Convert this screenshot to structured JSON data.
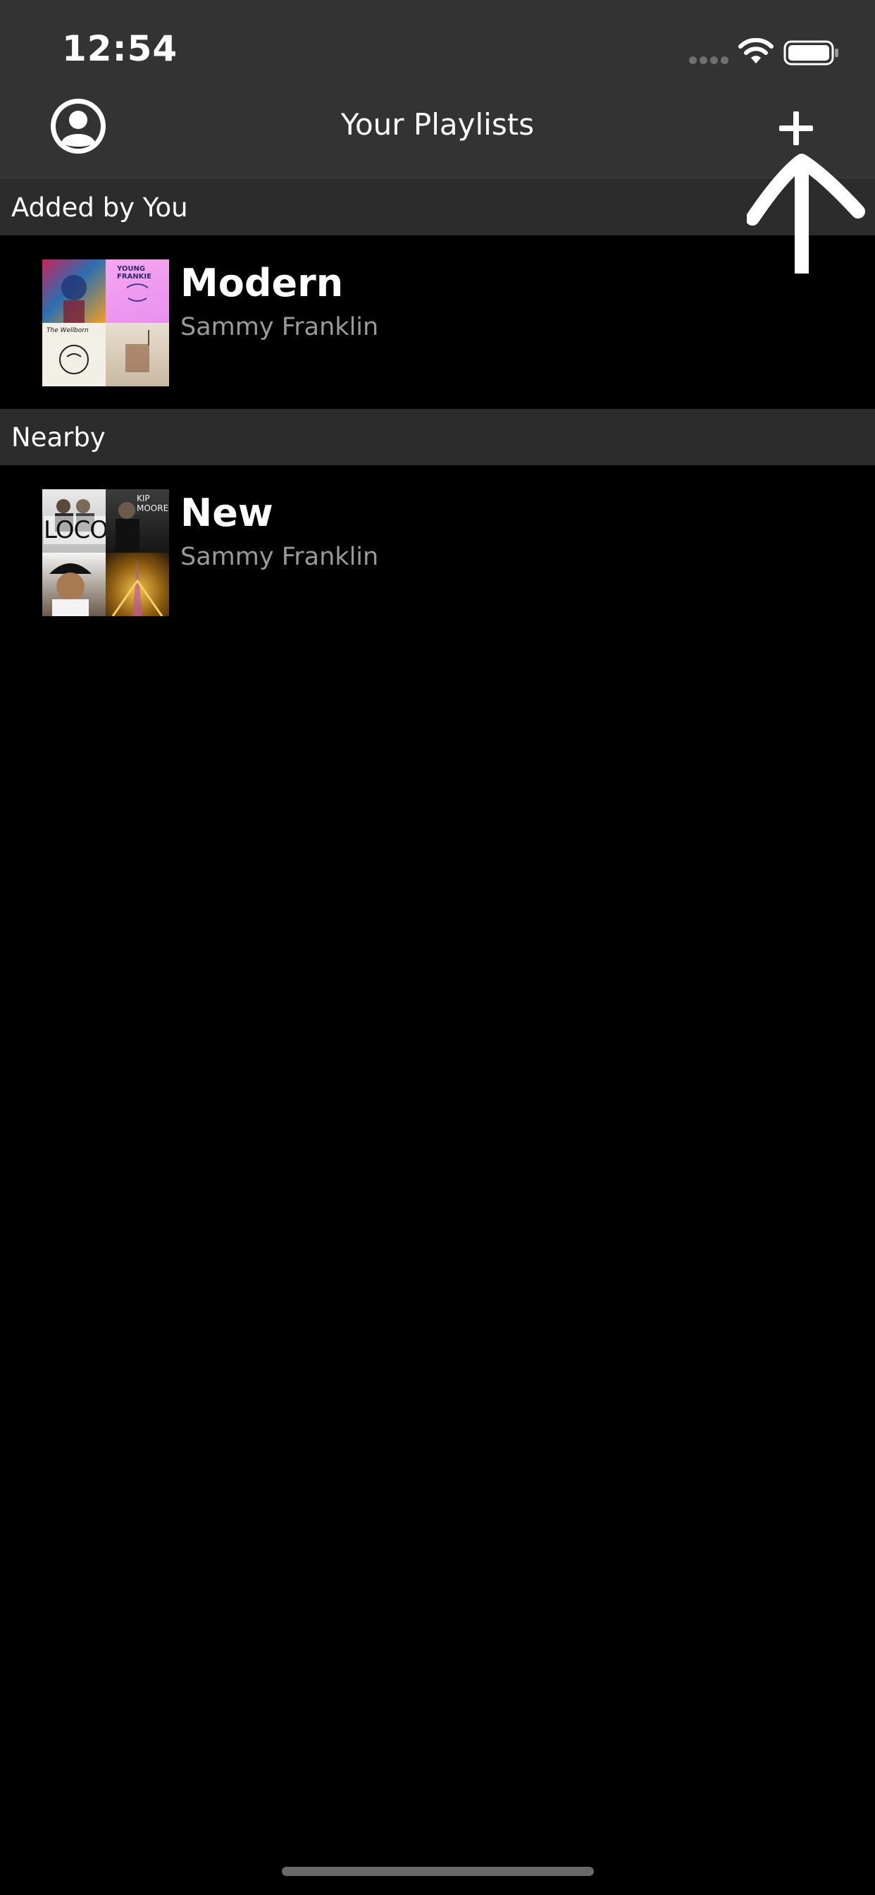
{
  "status_bar": {
    "time": "12:54"
  },
  "nav": {
    "title": "Your Playlists",
    "profile_icon": "person-circle-icon",
    "add_icon": "plus-icon"
  },
  "sections": [
    {
      "header": "Added by You",
      "playlists": [
        {
          "title": "Modern",
          "owner": "Sammy Franklin",
          "cover_texts": [
            "YOUNG FRANKIE",
            "The Wellborn"
          ]
        }
      ]
    },
    {
      "header": "Nearby",
      "playlists": [
        {
          "title": "New",
          "owner": "Sammy Franklin",
          "cover_texts": [
            "LOCO",
            "KIP MOORE"
          ]
        }
      ]
    }
  ],
  "colors": {
    "background": "#000000",
    "nav_background": "#333333",
    "section_background": "#2c2c2c",
    "subtitle_gray": "#9a9a9a"
  }
}
